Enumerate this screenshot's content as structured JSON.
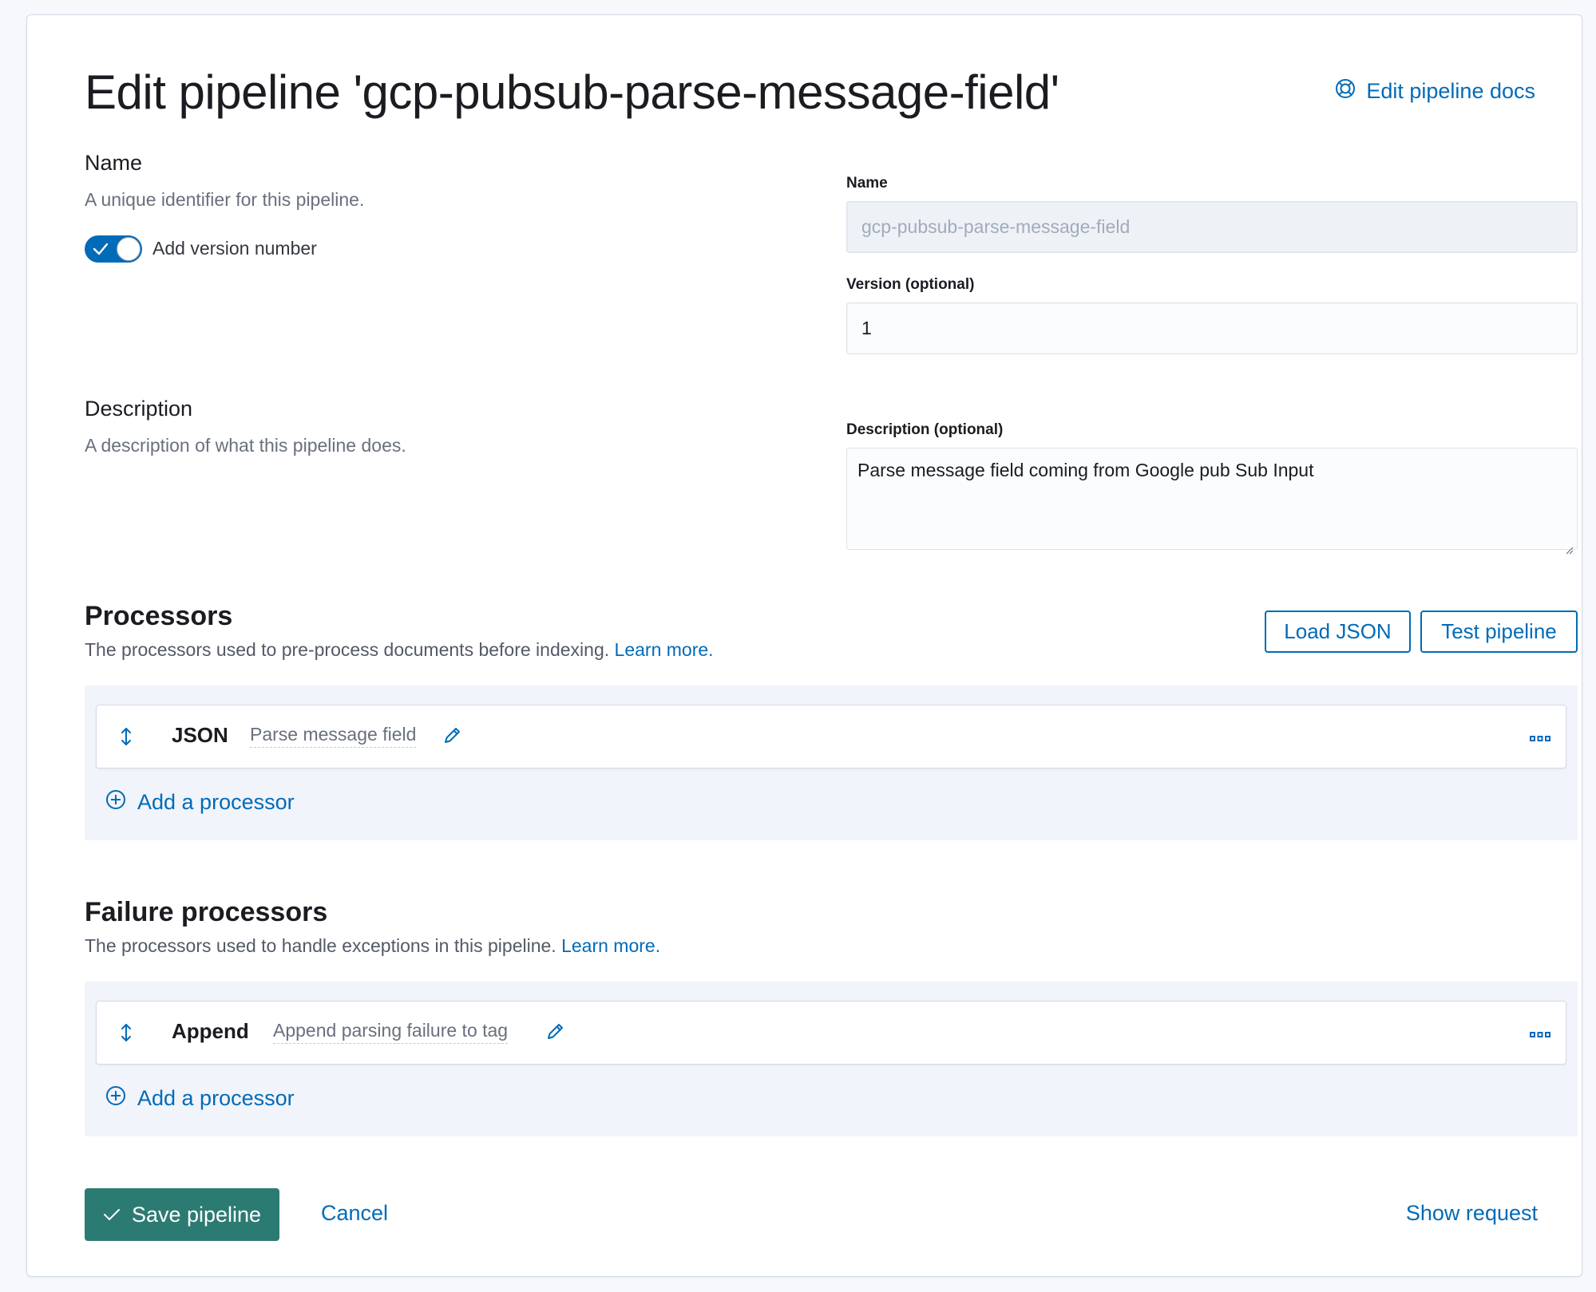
{
  "header": {
    "title": "Edit pipeline 'gcp-pubsub-parse-message-field'",
    "docs_link": "Edit pipeline docs"
  },
  "name_section": {
    "heading": "Name",
    "description": "A unique identifier for this pipeline.",
    "toggle_label": "Add version number",
    "toggle_on": true
  },
  "name_field": {
    "label": "Name",
    "value": "gcp-pubsub-parse-message-field"
  },
  "version_field": {
    "label": "Version (optional)",
    "value": "1"
  },
  "description_section": {
    "heading": "Description",
    "description": "A description of what this pipeline does."
  },
  "description_field": {
    "label": "Description (optional)",
    "value": "Parse message field coming from Google pub Sub Input"
  },
  "processors": {
    "heading": "Processors",
    "description": "The processors used to pre-process documents before indexing.",
    "learn_more": "Learn more.",
    "load_json": "Load JSON",
    "test_pipeline": "Test pipeline",
    "items": [
      {
        "type": "JSON",
        "description": "Parse message field"
      }
    ],
    "add_label": "Add a processor"
  },
  "failure_processors": {
    "heading": "Failure processors",
    "description": "The processors used to handle exceptions in this pipeline.",
    "learn_more": "Learn more.",
    "items": [
      {
        "type": "Append",
        "description": "Append parsing failure to tag"
      }
    ],
    "add_label": "Add a processor"
  },
  "footer": {
    "save": "Save pipeline",
    "cancel": "Cancel",
    "show_request": "Show request"
  },
  "colors": {
    "accent": "#006bb8",
    "save_button": "#2c7b73",
    "processor_area": "#f1f4fa"
  }
}
